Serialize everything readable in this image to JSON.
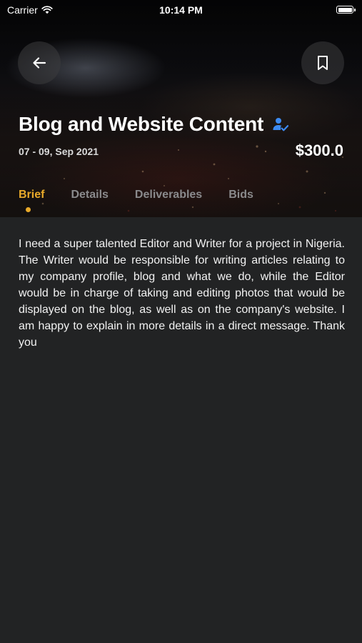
{
  "status_bar": {
    "carrier": "Carrier",
    "time": "10:14 PM"
  },
  "header": {
    "back_icon": "arrow-left-icon",
    "bookmark_icon": "bookmark-icon"
  },
  "job": {
    "title": "Blog and Website Content",
    "verified_icon": "user-check-icon",
    "date_range": "07 - 09, Sep 2021",
    "price": "$300.0"
  },
  "tabs": [
    {
      "label": "Brief",
      "active": true
    },
    {
      "label": "Details",
      "active": false
    },
    {
      "label": "Deliverables",
      "active": false
    },
    {
      "label": "Bids",
      "active": false
    }
  ],
  "brief": {
    "text": "I need a super talented Editor and Writer for a project in Nigeria. The Writer would be responsible for writing articles relating to my company profile, blog and what we do, while the Editor would be in charge of taking and editing photos that would be displayed on the blog, as well as on the company's website. I am happy to explain in more details in a direct message. Thank you"
  },
  "colors": {
    "background": "#222324",
    "accent": "#e8a92a",
    "tab_inactive": "#8a8a8c",
    "verified_blue": "#3d8bf2"
  }
}
